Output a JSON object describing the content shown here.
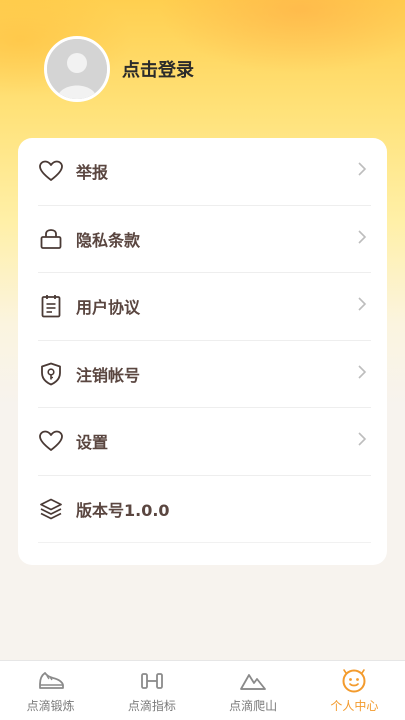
{
  "header": {
    "login_label": "点击登录"
  },
  "menu": {
    "items": [
      {
        "label": "举报",
        "icon": "heart-icon",
        "chevron": true
      },
      {
        "label": "隐私条款",
        "icon": "lock-icon",
        "chevron": true
      },
      {
        "label": "用户协议",
        "icon": "clipboard-icon",
        "chevron": true
      },
      {
        "label": "注销帐号",
        "icon": "shield-key-icon",
        "chevron": true
      },
      {
        "label": "设置",
        "icon": "heart-icon",
        "chevron": true
      },
      {
        "label": "版本号1.0.0",
        "icon": "layers-icon",
        "chevron": false
      }
    ]
  },
  "tabbar": {
    "tabs": [
      {
        "label": "点滴锻炼",
        "icon": "shoe-icon",
        "active": false
      },
      {
        "label": "点滴指标",
        "icon": "dumbbell-icon",
        "active": false
      },
      {
        "label": "点滴爬山",
        "icon": "mountain-icon",
        "active": false
      },
      {
        "label": "个人中心",
        "icon": "smile-face-icon",
        "active": true
      }
    ]
  },
  "colors": {
    "accent": "#f39b2d",
    "menu_text": "#5a4640",
    "header_gradient_top": "#ffcf4f"
  }
}
